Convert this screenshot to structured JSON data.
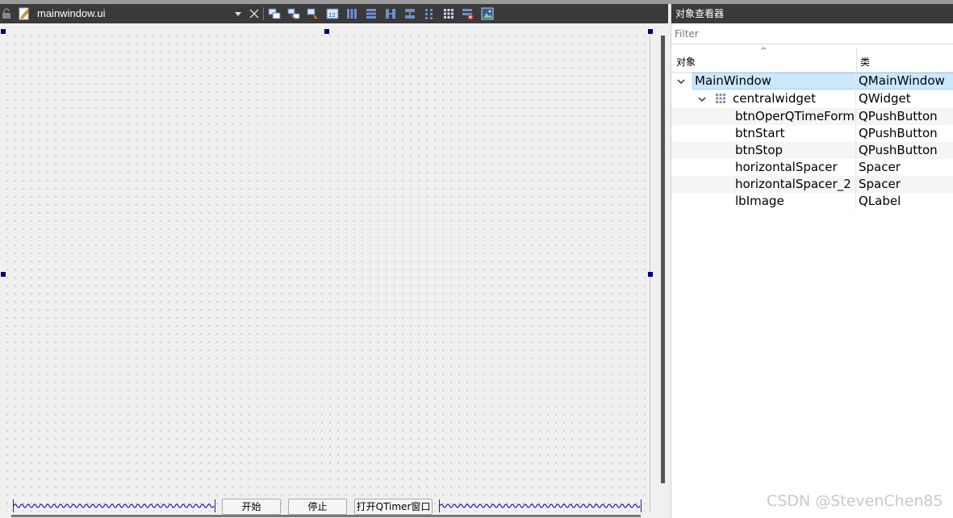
{
  "editor": {
    "file_name": "mainwindow.ui",
    "toolbar_icons": [
      "widget-editing-mode-icon",
      "signals-slots-mode-icon",
      "buddy-mode-icon",
      "tab-order-mode-icon",
      "layout-horizontal-icon",
      "layout-vertical-icon",
      "layout-horizontal-splitter-icon",
      "layout-vertical-splitter-icon",
      "layout-form-icon",
      "layout-grid-icon",
      "break-layout-icon",
      "adjust-size-icon"
    ]
  },
  "form": {
    "buttons": {
      "start": "开始",
      "stop": "停止",
      "open_timer": "打开QTimer窗口"
    }
  },
  "object_inspector": {
    "title": "对象查看器",
    "filter_placeholder": "Filter",
    "columns": {
      "object": "对象",
      "class": "类"
    },
    "rows": [
      {
        "name": "MainWindow",
        "class": "QMainWindow",
        "level": 0,
        "expanded": true,
        "selected": true
      },
      {
        "name": "centralwidget",
        "class": "QWidget",
        "level": 1,
        "expanded": true,
        "icon": "grid-layout-icon"
      },
      {
        "name": "btnOperQTimeForm",
        "class": "QPushButton",
        "level": 2
      },
      {
        "name": "btnStart",
        "class": "QPushButton",
        "level": 2
      },
      {
        "name": "btnStop",
        "class": "QPushButton",
        "level": 2
      },
      {
        "name": "horizontalSpacer",
        "class": "Spacer",
        "level": 2
      },
      {
        "name": "horizontalSpacer_2",
        "class": "Spacer",
        "level": 2
      },
      {
        "name": "lbImage",
        "class": "QLabel",
        "level": 2
      }
    ]
  },
  "watermark": "CSDN @StevenChen85",
  "colors": {
    "toolbar_bg": "#3a3a3a",
    "selection_bg": "#cce8ff",
    "selection_border": "#99d1ff",
    "handle": "#000080",
    "spacer": "#1f1fb5"
  }
}
